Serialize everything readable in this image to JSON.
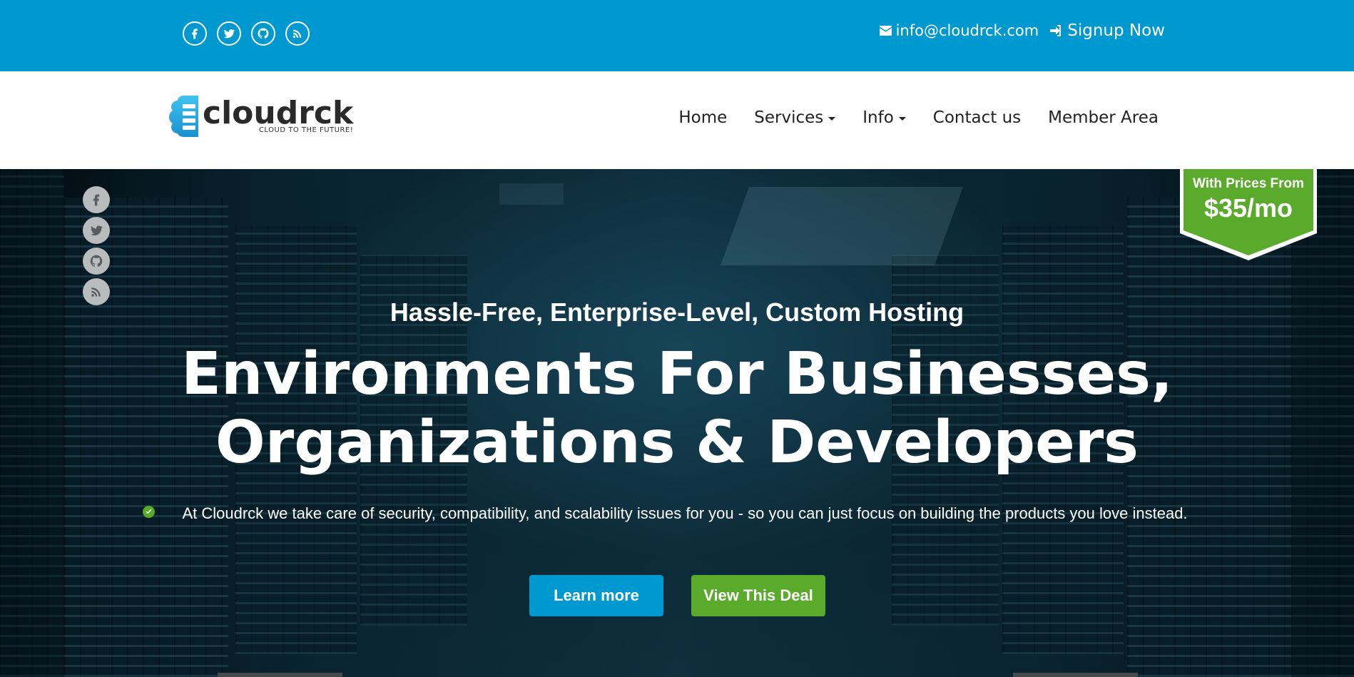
{
  "topbar": {
    "social_icons": [
      "facebook-icon",
      "twitter-icon",
      "github-icon",
      "rss-icon"
    ],
    "email": "info@cloudrck.com",
    "signup_label": "Signup Now"
  },
  "brand": {
    "name": "cloudrck",
    "tagline": "CLOUD TO THE FUTURE!"
  },
  "nav": {
    "items": [
      {
        "label": "Home"
      },
      {
        "label": "Services"
      },
      {
        "label": "Info"
      },
      {
        "label": "Contact us"
      },
      {
        "label": "Member Area"
      }
    ]
  },
  "hero": {
    "side_social_icons": [
      "facebook-icon",
      "twitter-icon",
      "github-icon",
      "rss-icon"
    ],
    "badge_label": "With Prices From",
    "badge_price": "$35/mo",
    "subheading": "Hassle-Free, Enterprise-Level, Custom Hosting",
    "headline_line1": "Environments For Businesses,",
    "headline_line2": "Organizations & Developers",
    "description": "At Cloudrck we take care of security, compatibility, and scalability issues for you - so you can just focus on building the products you love instead.",
    "learn_more_label": "Learn more",
    "deal_label": "View This Deal"
  },
  "colors": {
    "primary_blue": "#0099cf",
    "accent_green": "#5aab2b",
    "nav_text": "#222222"
  }
}
